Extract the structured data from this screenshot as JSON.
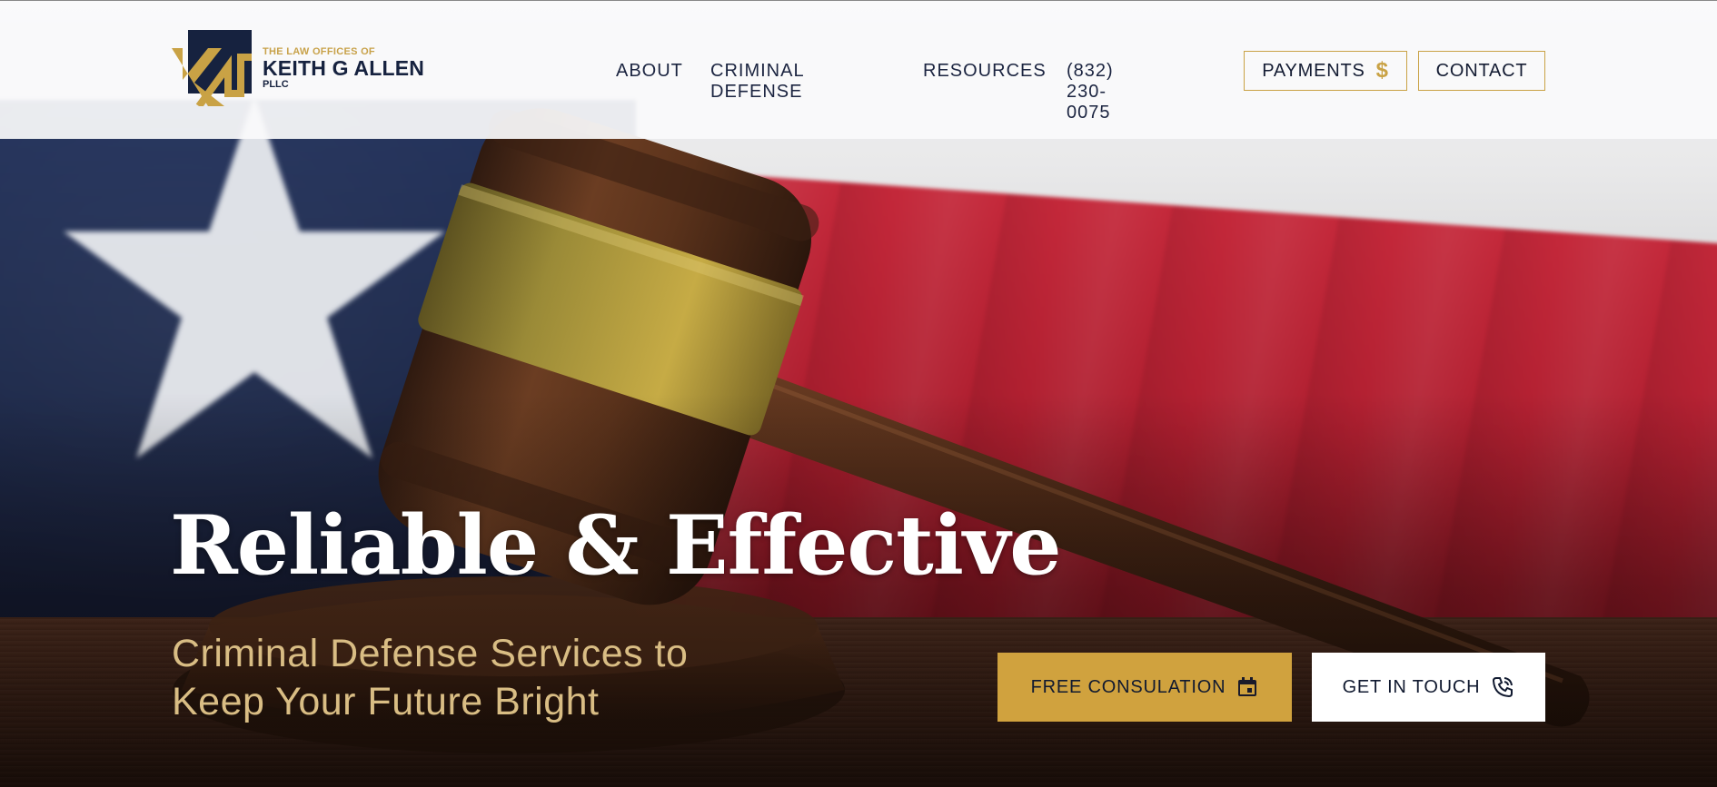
{
  "brand": {
    "superscript": "THE LAW OFFICES OF",
    "name": "KEITH G ALLEN",
    "suffix": "PLLC",
    "colors": {
      "navy": "#16223f",
      "gold": "#c9a245"
    }
  },
  "nav": {
    "about": "ABOUT",
    "criminal_defense": "CRIMINAL DEFENSE",
    "resources": "RESOURCES",
    "phone": "(832) 230-0075",
    "payments": "PAYMENTS",
    "payments_icon": "dollar-icon",
    "contact": "CONTACT"
  },
  "hero": {
    "headline": "Reliable & Effective",
    "subheadline": "Criminal Defense Services to Keep Your Future Bright",
    "cta_primary": {
      "label": "FREE CONSULATION",
      "icon": "calendar-icon",
      "color": "#d0a23e"
    },
    "cta_secondary": {
      "label": "GET IN TOUCH",
      "icon": "phone-icon",
      "color": "#ffffff"
    }
  }
}
